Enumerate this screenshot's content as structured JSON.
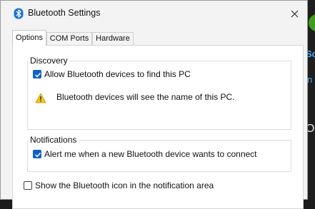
{
  "window": {
    "title": "Bluetooth Settings"
  },
  "tabs": [
    {
      "label": "Options",
      "active": true
    },
    {
      "label": "COM Ports",
      "active": false
    },
    {
      "label": "Hardware",
      "active": false
    }
  ],
  "discovery": {
    "label": "Discovery",
    "allow_checkbox": {
      "label": "Allow Bluetooth devices to find this PC",
      "checked": true
    },
    "warning_text": "Bluetooth devices will see the name of this PC."
  },
  "notifications": {
    "label": "Notifications",
    "alert_checkbox": {
      "label": "Alert me when a new Bluetooth device wants to connect",
      "checked": true
    }
  },
  "show_icon_checkbox": {
    "label": "Show the Bluetooth icon in the notification area",
    "checked": false
  },
  "background_app": {
    "text_1": "Sc",
    "text_2": "n",
    "text_3": "O"
  },
  "colors": {
    "accent": "#0a63c9",
    "warning": "#f5c518"
  }
}
